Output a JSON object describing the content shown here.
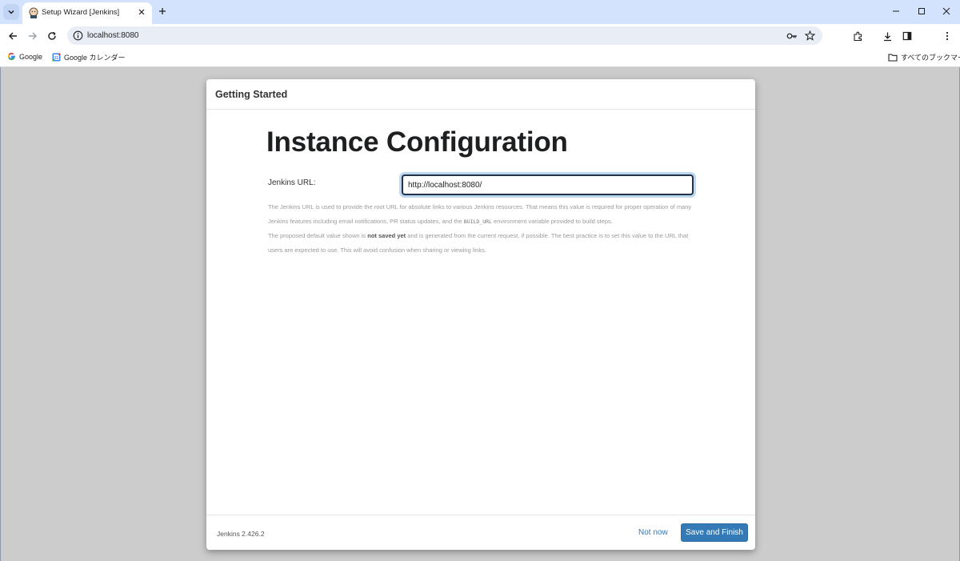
{
  "browser": {
    "tab_title": "Setup Wizard [Jenkins]",
    "url": "localhost:8080",
    "bookmarks": [
      {
        "label": "Google",
        "icon": "google-icon"
      },
      {
        "label": "Google カレンダー",
        "icon": "google-calendar-icon"
      }
    ],
    "all_bookmarks_label": "すべてのブックマーク"
  },
  "dialog": {
    "header": "Getting Started",
    "title": "Instance Configuration",
    "url_label": "Jenkins URL:",
    "url_value": "http://localhost:8080/",
    "help_p1_a": "The Jenkins URL is used to provide the root URL for absolute links to various Jenkins resources. That means this value is required for proper operation of many Jenkins features including email notifications, PR status updates, and the ",
    "help_p1_code": "BUILD_URL",
    "help_p1_b": " environment variable provided to build steps.",
    "help_p2_a": "The proposed default value shown is ",
    "help_p2_strong": "not saved yet",
    "help_p2_b": " and is generated from the current request, if possible. The best practice is to set this value to the URL that users are expected to use. This will avoid confusion when sharing or viewing links.",
    "version": "Jenkins 2.426.2",
    "not_now": "Not now",
    "save_finish": "Save and Finish"
  },
  "colors": {
    "tabstrip_bg": "#d3e3fd",
    "primary_button": "#337ab7",
    "page_bg": "#cccccc"
  }
}
